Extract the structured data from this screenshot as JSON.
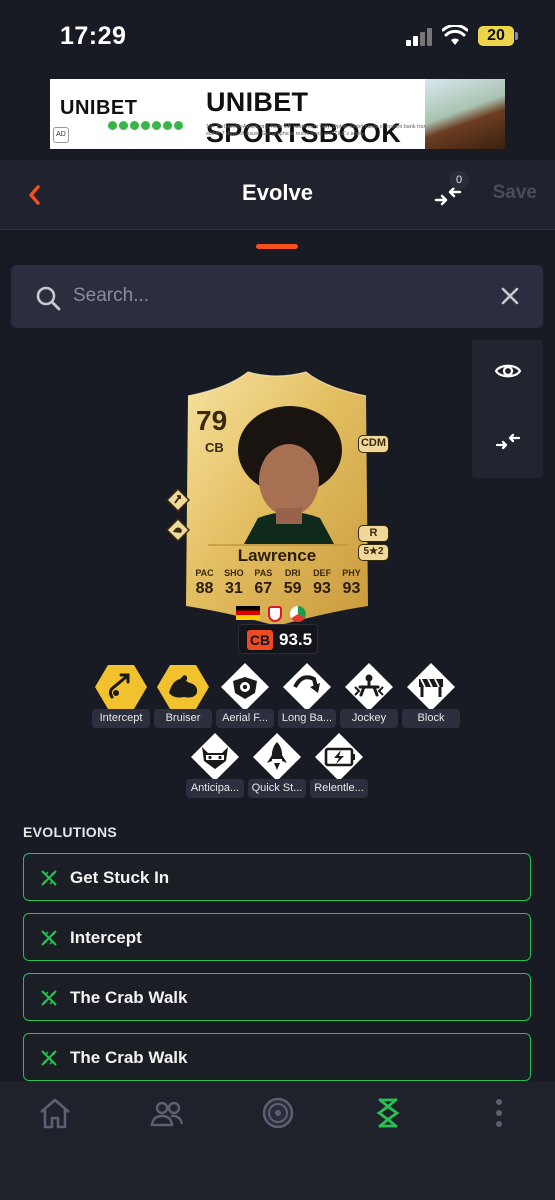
{
  "status_bar": {
    "time": "17:29",
    "battery": "20"
  },
  "ad": {
    "logo_text": "UNIBET",
    "headline": "UNIBET SPORTSBOOK",
    "fineprint": "18+ BeGambleAware.org. New GB customers only. Opt in. Debit cards or instant bank transfers only. Free bets expire within 7 days of issue. Geographical restrictions and T&C's apply.",
    "badge": "AD"
  },
  "header": {
    "title": "Evolve",
    "compare_count": "0",
    "save_label": "Save"
  },
  "search": {
    "placeholder": "Search..."
  },
  "card": {
    "rating": "79",
    "position": "CB",
    "alt_position": "CDM",
    "foot": "R",
    "skill": "5★2",
    "name": "Lawrence",
    "stats": [
      {
        "label": "PAC",
        "value": "88"
      },
      {
        "label": "SHO",
        "value": "31"
      },
      {
        "label": "PAS",
        "value": "67"
      },
      {
        "label": "DRI",
        "value": "59"
      },
      {
        "label": "DEF",
        "value": "93"
      },
      {
        "label": "PHY",
        "value": "93"
      }
    ]
  },
  "position_rating": {
    "position": "CB",
    "value": "93.5"
  },
  "playstyles": [
    {
      "label": "Intercept",
      "plus": true
    },
    {
      "label": "Bruiser",
      "plus": true
    },
    {
      "label": "Aerial F...",
      "plus": false
    },
    {
      "label": "Long Ba...",
      "plus": false
    },
    {
      "label": "Jockey",
      "plus": false
    },
    {
      "label": "Block",
      "plus": false
    },
    {
      "label": "Anticipa...",
      "plus": false
    },
    {
      "label": "Quick St...",
      "plus": false
    },
    {
      "label": "Relentle...",
      "plus": false
    }
  ],
  "evolutions": {
    "title": "EVOLUTIONS",
    "items": [
      {
        "label": "Get Stuck In"
      },
      {
        "label": "Intercept"
      },
      {
        "label": "The Crab Walk"
      },
      {
        "label": "The Crab Walk"
      }
    ]
  },
  "colors": {
    "background": "#191b24",
    "accent_orange": "#f24f1d",
    "evo_green": "#26c152",
    "card_gold": "#e6c46a",
    "ps_plus_gold": "#f2c12e"
  }
}
